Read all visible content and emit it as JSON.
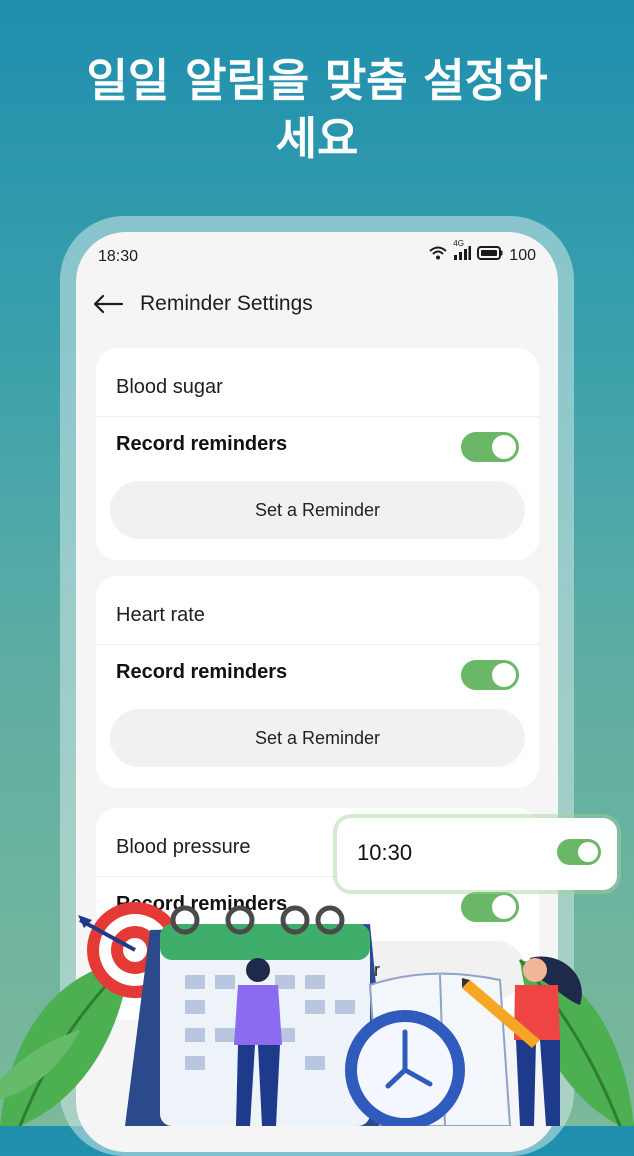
{
  "headline": {
    "line1": "일일 알림을 맞춤 설정하",
    "line2": "세요"
  },
  "status_bar": {
    "time": "18:30",
    "network": "4G",
    "battery": "100",
    "icons": [
      "wifi-icon",
      "signal-icon",
      "battery-icon"
    ]
  },
  "appbar": {
    "title": "Reminder Settings",
    "back_icon": "back-arrow-icon"
  },
  "cards": [
    {
      "title": "Blood sugar",
      "row_label": "Record reminders",
      "toggle_on": true,
      "button": "Set a Reminder"
    },
    {
      "title": "Heart rate",
      "row_label": "Record reminders",
      "toggle_on": true,
      "button": "Set a Reminder"
    },
    {
      "title": "Blood pressure",
      "row_label": "Record reminders",
      "toggle_on": true,
      "button": "Set a Reminder"
    }
  ],
  "time_popup": {
    "time": "10:30",
    "toggle_on": true
  },
  "colors": {
    "accent_green": "#6ab867",
    "bg_top": "#1f8fae",
    "bg_bottom": "#7cb89a"
  }
}
